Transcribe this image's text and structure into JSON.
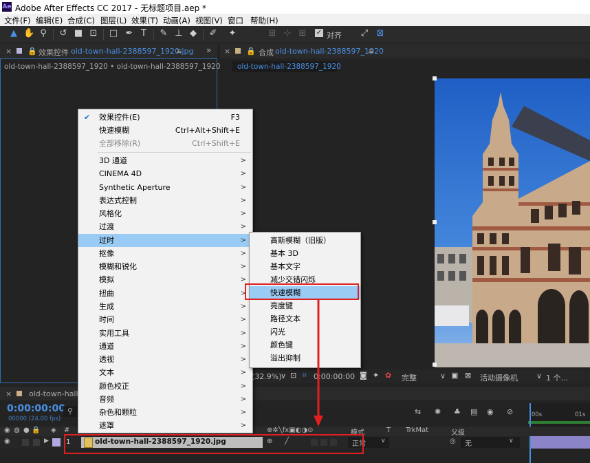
{
  "window": {
    "title": "Adobe After Effects CC 2017 - 无标题项目.aep *",
    "logo": "Ae"
  },
  "menubar": [
    "文件(F)",
    "编辑(E)",
    "合成(C)",
    "图层(L)",
    "效果(T)",
    "动画(A)",
    "视图(V)",
    "窗口",
    "帮助(H)"
  ],
  "toolbar": {
    "snap_label": "对齐"
  },
  "effect_controls": {
    "tab_prefix": "效果控件",
    "tab_file": "old-town-hall-2388597_1920.jpg",
    "subtitle": "old-town-hall-2388597_1920 • old-town-hall-2388597_1920.jpg"
  },
  "composition": {
    "tab_prefix": "合成",
    "tab_name": "old-town-hall-2388597_1920",
    "sub_tab": "old-town-hall-2388597_1920",
    "zoom": "(32.9%)",
    "timecode": "0:00:00:00",
    "quality": "完整",
    "camera": "活动摄像机",
    "views": "1 个..."
  },
  "effect_menu": {
    "items": [
      {
        "label": "效果控件(E)",
        "shortcut": "F3",
        "checked": true
      },
      {
        "label": "快速模糊",
        "shortcut": "Ctrl+Alt+Shift+E"
      },
      {
        "label": "全部移除(R)",
        "shortcut": "Ctrl+Shift+E",
        "disabled": true
      },
      {
        "label": "3D 通道",
        "submenu": true
      },
      {
        "label": "CINEMA 4D",
        "submenu": true
      },
      {
        "label": "Synthetic Aperture",
        "submenu": true
      },
      {
        "label": "表达式控制",
        "submenu": true
      },
      {
        "label": "风格化",
        "submenu": true
      },
      {
        "label": "过渡",
        "submenu": true
      },
      {
        "label": "过时",
        "submenu": true,
        "selected": true
      },
      {
        "label": "抠像",
        "submenu": true
      },
      {
        "label": "模糊和锐化",
        "submenu": true
      },
      {
        "label": "模拟",
        "submenu": true
      },
      {
        "label": "扭曲",
        "submenu": true
      },
      {
        "label": "生成",
        "submenu": true
      },
      {
        "label": "时间",
        "submenu": true
      },
      {
        "label": "实用工具",
        "submenu": true
      },
      {
        "label": "通道",
        "submenu": true
      },
      {
        "label": "透视",
        "submenu": true
      },
      {
        "label": "文本",
        "submenu": true
      },
      {
        "label": "颜色校正",
        "submenu": true
      },
      {
        "label": "音频",
        "submenu": true
      },
      {
        "label": "杂色和颗粒",
        "submenu": true
      },
      {
        "label": "遮罩",
        "submenu": true
      }
    ]
  },
  "obsolete_submenu": {
    "items": [
      {
        "label": "高斯模糊（旧版）"
      },
      {
        "label": "基本 3D"
      },
      {
        "label": "基本文字"
      },
      {
        "label": "减少交错闪烁"
      },
      {
        "label": "快速模糊",
        "selected": true
      },
      {
        "label": "亮度键"
      },
      {
        "label": "路径文本"
      },
      {
        "label": "闪光"
      },
      {
        "label": "颜色键"
      },
      {
        "label": "溢出抑制"
      }
    ]
  },
  "timeline": {
    "tab": "old-town-hall-2388597_1920",
    "timecode": "0:00:00:00",
    "frames": "00000 (24.00 fps)",
    "col_hash": "#",
    "col_mode": "模式",
    "col_t": "T",
    "col_trkmat": "TrkMat",
    "col_parent": "父级",
    "ruler_start": ":00s",
    "ruler_01s": "01s",
    "layer": {
      "index": "1",
      "name": "old-town-hall-2388597_1920.jpg",
      "mode": "正常",
      "parent": "无"
    }
  },
  "colors": {
    "accent": "#4a90e2",
    "highlight": "#e02020",
    "menu_selected": "#99cbf5"
  }
}
